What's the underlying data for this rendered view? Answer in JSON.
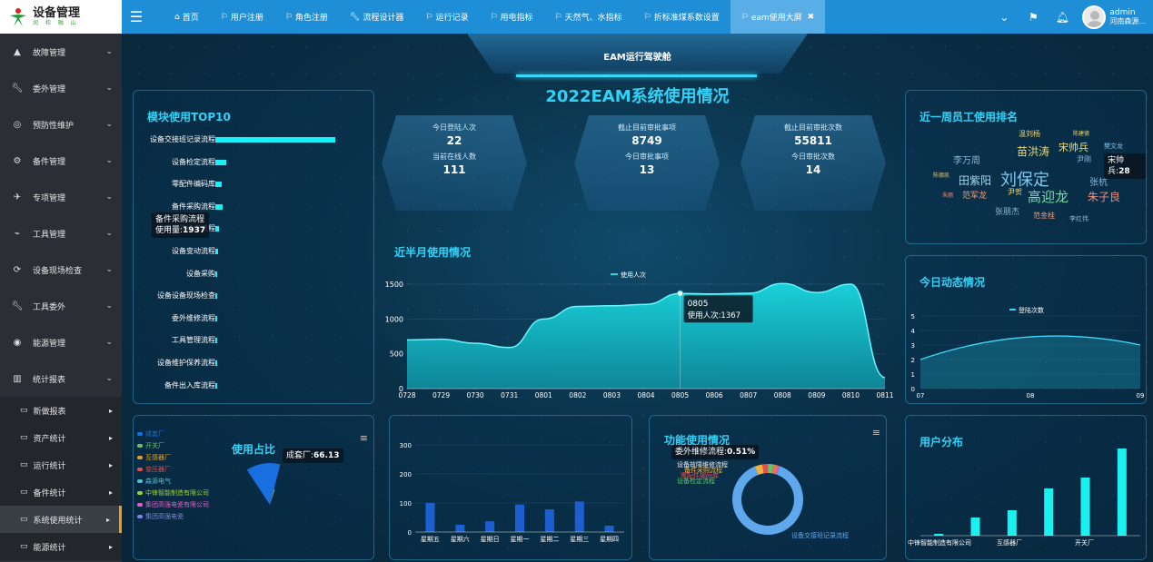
{
  "app": {
    "title": "设备管理",
    "subtitle": "润 和 融 山"
  },
  "tabs": [
    {
      "label": "首页",
      "icon": "home-icon"
    },
    {
      "label": "用户注册",
      "icon": "flag-icon"
    },
    {
      "label": "角色注册",
      "icon": "flag-icon"
    },
    {
      "label": "流程设计器",
      "icon": "wrench-icon"
    },
    {
      "label": "运行记录",
      "icon": "flag-icon"
    },
    {
      "label": "用电指标",
      "icon": "flag-icon"
    },
    {
      "label": "天然气、水指标",
      "icon": "flag-icon"
    },
    {
      "label": "折标准煤系数设置",
      "icon": "flag-icon"
    },
    {
      "label": "eam使用大屏",
      "icon": "flag-icon",
      "active": true
    }
  ],
  "user": {
    "name": "admin",
    "company": "河南森源..."
  },
  "sidebar": {
    "items": [
      {
        "label": "故障管理",
        "icon": "warning-icon"
      },
      {
        "label": "委外管理",
        "icon": "wrench-icon"
      },
      {
        "label": "预防性维护",
        "icon": "target-icon"
      },
      {
        "label": "备件管理",
        "icon": "gears-icon"
      },
      {
        "label": "专项管理",
        "icon": "plane-icon"
      },
      {
        "label": "工具管理",
        "icon": "paperclip-icon"
      },
      {
        "label": "设备现场检查",
        "icon": "refresh-icon"
      },
      {
        "label": "工具委外",
        "icon": "wrench-icon"
      },
      {
        "label": "能源管理",
        "icon": "lifebuoy-icon"
      },
      {
        "label": "统计报表",
        "icon": "bar-chart-icon"
      }
    ],
    "subitems": [
      {
        "label": "新做报表"
      },
      {
        "label": "资产统计"
      },
      {
        "label": "运行统计"
      },
      {
        "label": "备件统计"
      },
      {
        "label": "系统使用统计",
        "active": true
      },
      {
        "label": "能源统计"
      }
    ]
  },
  "dashboard": {
    "header": "EAM运行驾驶舱",
    "title": "2022EAM系统使用情况"
  },
  "top10": {
    "title": "模块使用TOP10",
    "tooltip": {
      "label": "备件采购流程",
      "value_label": "使用量:",
      "value": "1937"
    },
    "value_max": 32000
  },
  "stats": [
    {
      "l1": "今日登陆人次",
      "v1": "22",
      "l2": "当前在线人数",
      "v2": "111"
    },
    {
      "l1": "截止目前审批事项",
      "v1": "8749",
      "l2": "今日审批事项",
      "v2": "13"
    },
    {
      "l1": "截止目前审批次数",
      "v1": "55811",
      "l2": "今日审批次数",
      "v2": "14"
    }
  ],
  "half_month": {
    "title": "近半月使用情况",
    "legend": "使用人次",
    "tooltip": {
      "date": "0805",
      "label": "使用人次:",
      "value": "1367"
    }
  },
  "ranking": {
    "title": "近一周员工使用排名",
    "tooltip": {
      "name": "宋帅兵",
      "value": "28"
    },
    "words": [
      {
        "text": "温刘杨",
        "color": "#e8d67a"
      },
      {
        "text": "陈建德",
        "color": "#e8d67a"
      },
      {
        "text": "苗洪涛",
        "color": "#e8d67a"
      },
      {
        "text": "宋帅兵",
        "color": "#f0e06a"
      },
      {
        "text": "樊文龙",
        "color": "#7fc4e8"
      },
      {
        "text": "李万周",
        "color": "#8ab8d8"
      },
      {
        "text": "尹刚",
        "color": "#8ab8d8"
      },
      {
        "text": "田紫阳",
        "color": "#a9d8f0"
      },
      {
        "text": "刘保定",
        "color": "#7fc8f0"
      },
      {
        "text": "张杭",
        "color": "#8ab8d8"
      },
      {
        "text": "陈德凯",
        "color": "#e8c07a"
      },
      {
        "text": "尹贺",
        "color": "#e8d67a"
      },
      {
        "text": "朱丽",
        "color": "#e89080"
      },
      {
        "text": "范军龙",
        "color": "#e8a080"
      },
      {
        "text": "高迎龙",
        "color": "#6fe0a0"
      },
      {
        "text": "朱子良",
        "color": "#e89080"
      },
      {
        "text": "张朋杰",
        "color": "#8ab8d8"
      },
      {
        "text": "范金桂",
        "color": "#e8a080"
      },
      {
        "text": "李红伟",
        "color": "#8ab8d8"
      }
    ]
  },
  "today": {
    "title": "今日动态情况",
    "legend": "登陆次数"
  },
  "usage_ratio": {
    "title": "使用占比",
    "tooltip": {
      "label": "成套厂:",
      "value": "66.13"
    },
    "legend": [
      {
        "label": "成套厂",
        "color": "#1a6fe0"
      },
      {
        "label": "开关厂",
        "color": "#6ec06e"
      },
      {
        "label": "互感器厂",
        "color": "#e0a030"
      },
      {
        "label": "变压器厂",
        "color": "#e05050"
      },
      {
        "label": "森源电气",
        "color": "#50c0d0"
      },
      {
        "label": "中锋智能制造有限公司",
        "color": "#9ad040"
      },
      {
        "label": "集团高强电瓷有限公司",
        "color": "#e060c0"
      },
      {
        "label": "集团高强电瓷",
        "color": "#8080e0"
      }
    ]
  },
  "function_usage": {
    "title": "功能使用情况",
    "tooltip": {
      "label": "委外维修流程:",
      "value": "0.51%"
    },
    "labels": [
      "设备故障维修流程",
      "备件采购流程",
      "零配件编码库",
      "设备检定流程",
      "设备交接班记录流程"
    ]
  },
  "user_dist": {
    "title": "用户分布",
    "labels": [
      "中锋智能制造有限公司",
      "互感器厂",
      "开关厂"
    ]
  },
  "chart_data": [
    {
      "type": "bar",
      "title": "模块使用TOP10",
      "categories": [
        "设备交接班记录流程",
        "设备检定流程",
        "零配件编码库",
        "备件采购流程",
        "设备故障维修流程",
        "设备变动流程",
        "设备采购",
        "设备设备现场检查",
        "委外维修流程",
        "工具管理流程",
        "设备维护保养流程",
        "备件出入库流程"
      ],
      "values": [
        31000,
        2800,
        1700,
        1937,
        1000,
        600,
        500,
        400,
        300,
        250,
        200,
        150
      ]
    },
    {
      "type": "area",
      "title": "近半月使用情况",
      "x": [
        "0728",
        "0729",
        "0730",
        "0731",
        "0801",
        "0802",
        "0803",
        "0804",
        "0805",
        "0806",
        "0807",
        "0808",
        "0809",
        "0810",
        "0811"
      ],
      "series": [
        {
          "name": "使用人次",
          "values": [
            700,
            710,
            650,
            590,
            1000,
            1180,
            1190,
            1210,
            1367,
            1360,
            1370,
            1510,
            1380,
            1500,
            160
          ]
        }
      ],
      "ylim": [
        0,
        1500
      ],
      "yticks": [
        0,
        500,
        1000,
        1500
      ]
    },
    {
      "type": "area",
      "title": "今日动态情况",
      "x": [
        "07",
        "08",
        "09"
      ],
      "series": [
        {
          "name": "登陆次数",
          "values": [
            2,
            4,
            3
          ]
        }
      ],
      "ylim": [
        0,
        5
      ],
      "yticks": [
        0,
        1,
        2,
        3,
        4,
        5
      ]
    },
    {
      "type": "bar",
      "categories": [
        "星期五",
        "星期六",
        "星期日",
        "星期一",
        "星期二",
        "星期三",
        "星期四"
      ],
      "values": [
        100,
        25,
        37,
        95,
        78,
        105,
        22
      ],
      "ylim": [
        0,
        300
      ],
      "yticks": [
        0,
        100,
        200,
        300
      ]
    },
    {
      "type": "pie",
      "title": "使用占比",
      "categories": [
        "成套厂",
        "开关厂",
        "互感器厂"
      ],
      "values": [
        66.13,
        3,
        2
      ]
    },
    {
      "type": "pie",
      "title": "功能使用情况",
      "categories": [
        "设备交接班记录流程",
        "设备检定流程",
        "零配件编码库",
        "备件采购流程",
        "设备故障维修流程",
        "委外维修流程"
      ],
      "values": [
        88.5,
        3.5,
        2.5,
        2.5,
        2.49,
        0.51
      ]
    },
    {
      "type": "bar",
      "title": "用户分布",
      "categories": [
        "",
        "中锋智能制造有限公司",
        "",
        "互感器厂",
        "",
        "开关厂"
      ],
      "values": [
        1,
        10,
        14,
        26,
        32,
        48
      ]
    }
  ]
}
